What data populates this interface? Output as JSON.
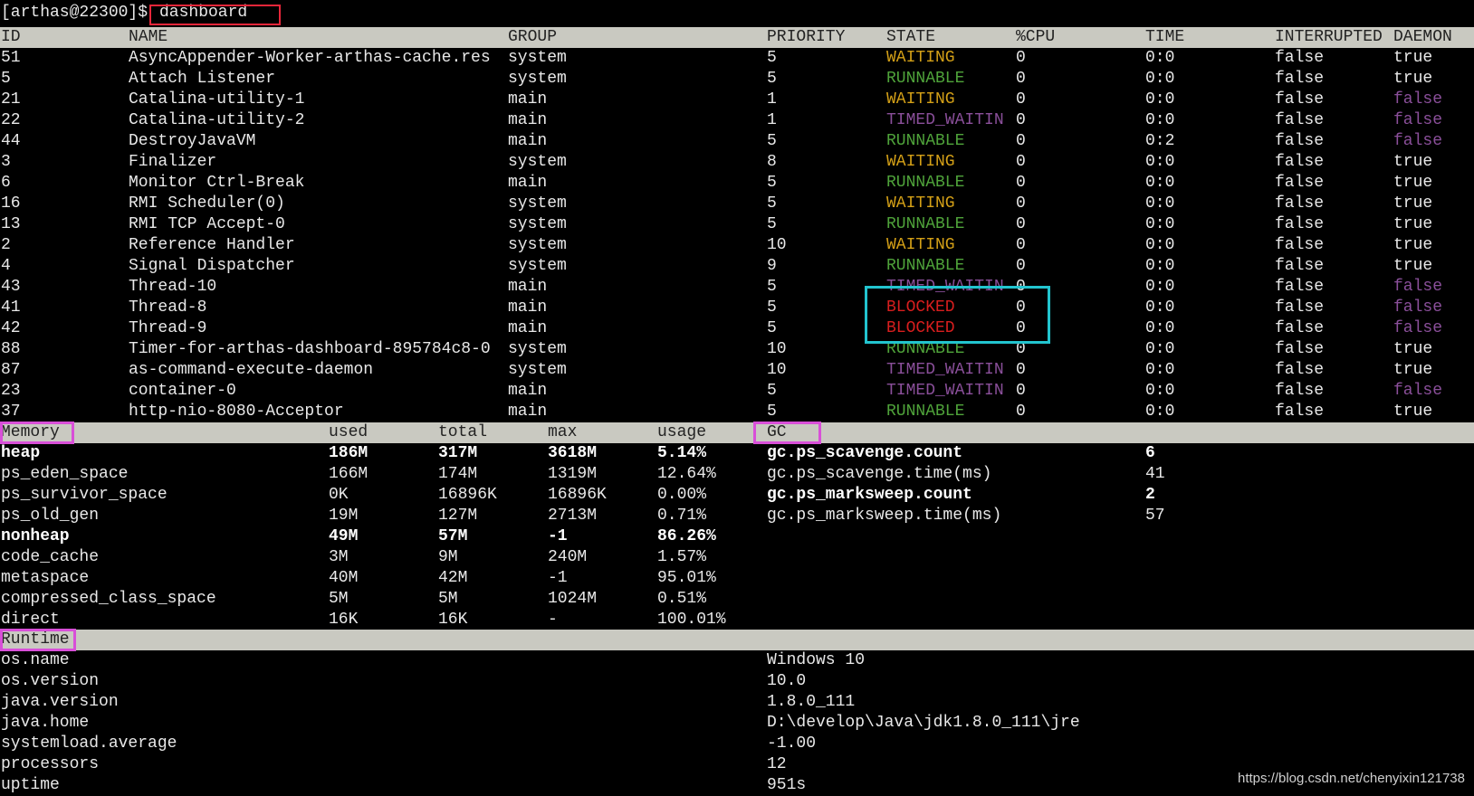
{
  "prompt": {
    "text": "[arthas@22300]$ ",
    "command": "dashboard"
  },
  "threads": {
    "headers": [
      "ID",
      "NAME",
      "GROUP",
      "PRIORITY",
      "STATE",
      "%CPU",
      "TIME",
      "INTERRUPTED",
      "DAEMON"
    ],
    "rows": [
      {
        "id": "51",
        "name": "AsyncAppender-Worker-arthas-cache.res",
        "group": "system",
        "priority": "5",
        "state": "WAITING",
        "cpu": "0",
        "time": "0:0",
        "interrupted": "false",
        "daemon": "true"
      },
      {
        "id": "5",
        "name": "Attach Listener",
        "group": "system",
        "priority": "5",
        "state": "RUNNABLE",
        "cpu": "0",
        "time": "0:0",
        "interrupted": "false",
        "daemon": "true"
      },
      {
        "id": "21",
        "name": "Catalina-utility-1",
        "group": "main",
        "priority": "1",
        "state": "WAITING",
        "cpu": "0",
        "time": "0:0",
        "interrupted": "false",
        "daemon": "false"
      },
      {
        "id": "22",
        "name": "Catalina-utility-2",
        "group": "main",
        "priority": "1",
        "state": "TIMED_WAITIN",
        "cpu": "0",
        "time": "0:0",
        "interrupted": "false",
        "daemon": "false"
      },
      {
        "id": "44",
        "name": "DestroyJavaVM",
        "group": "main",
        "priority": "5",
        "state": "RUNNABLE",
        "cpu": "0",
        "time": "0:2",
        "interrupted": "false",
        "daemon": "false"
      },
      {
        "id": "3",
        "name": "Finalizer",
        "group": "system",
        "priority": "8",
        "state": "WAITING",
        "cpu": "0",
        "time": "0:0",
        "interrupted": "false",
        "daemon": "true"
      },
      {
        "id": "6",
        "name": "Monitor Ctrl-Break",
        "group": "main",
        "priority": "5",
        "state": "RUNNABLE",
        "cpu": "0",
        "time": "0:0",
        "interrupted": "false",
        "daemon": "true"
      },
      {
        "id": "16",
        "name": "RMI Scheduler(0)",
        "group": "system",
        "priority": "5",
        "state": "WAITING",
        "cpu": "0",
        "time": "0:0",
        "interrupted": "false",
        "daemon": "true"
      },
      {
        "id": "13",
        "name": "RMI TCP Accept-0",
        "group": "system",
        "priority": "5",
        "state": "RUNNABLE",
        "cpu": "0",
        "time": "0:0",
        "interrupted": "false",
        "daemon": "true"
      },
      {
        "id": "2",
        "name": "Reference Handler",
        "group": "system",
        "priority": "10",
        "state": "WAITING",
        "cpu": "0",
        "time": "0:0",
        "interrupted": "false",
        "daemon": "true"
      },
      {
        "id": "4",
        "name": "Signal Dispatcher",
        "group": "system",
        "priority": "9",
        "state": "RUNNABLE",
        "cpu": "0",
        "time": "0:0",
        "interrupted": "false",
        "daemon": "true"
      },
      {
        "id": "43",
        "name": "Thread-10",
        "group": "main",
        "priority": "5",
        "state": "TIMED_WAITIN",
        "cpu": "0",
        "time": "0:0",
        "interrupted": "false",
        "daemon": "false"
      },
      {
        "id": "41",
        "name": "Thread-8",
        "group": "main",
        "priority": "5",
        "state": "BLOCKED",
        "cpu": "0",
        "time": "0:0",
        "interrupted": "false",
        "daemon": "false"
      },
      {
        "id": "42",
        "name": "Thread-9",
        "group": "main",
        "priority": "5",
        "state": "BLOCKED",
        "cpu": "0",
        "time": "0:0",
        "interrupted": "false",
        "daemon": "false"
      },
      {
        "id": "88",
        "name": "Timer-for-arthas-dashboard-895784c8-0",
        "group": "system",
        "priority": "10",
        "state": "RUNNABLE",
        "cpu": "0",
        "time": "0:0",
        "interrupted": "false",
        "daemon": "true"
      },
      {
        "id": "87",
        "name": "as-command-execute-daemon",
        "group": "system",
        "priority": "10",
        "state": "TIMED_WAITIN",
        "cpu": "0",
        "time": "0:0",
        "interrupted": "false",
        "daemon": "true"
      },
      {
        "id": "23",
        "name": "container-0",
        "group": "main",
        "priority": "5",
        "state": "TIMED_WAITIN",
        "cpu": "0",
        "time": "0:0",
        "interrupted": "false",
        "daemon": "false"
      },
      {
        "id": "37",
        "name": "http-nio-8080-Acceptor",
        "group": "main",
        "priority": "5",
        "state": "RUNNABLE",
        "cpu": "0",
        "time": "0:0",
        "interrupted": "false",
        "daemon": "true"
      }
    ]
  },
  "memory": {
    "headers": [
      "Memory",
      "used",
      "total",
      "max",
      "usage"
    ],
    "rows": [
      {
        "name": "heap",
        "used": "186M",
        "total": "317M",
        "max": "3618M",
        "usage": "5.14%",
        "bold": true
      },
      {
        "name": "ps_eden_space",
        "used": "166M",
        "total": "174M",
        "max": "1319M",
        "usage": "12.64%",
        "bold": false
      },
      {
        "name": "ps_survivor_space",
        "used": "0K",
        "total": "16896K",
        "max": "16896K",
        "usage": "0.00%",
        "bold": false
      },
      {
        "name": "ps_old_gen",
        "used": "19M",
        "total": "127M",
        "max": "2713M",
        "usage": "0.71%",
        "bold": false
      },
      {
        "name": "nonheap",
        "used": "49M",
        "total": "57M",
        "max": "-1",
        "usage": "86.26%",
        "bold": true
      },
      {
        "name": "code_cache",
        "used": "3M",
        "total": "9M",
        "max": "240M",
        "usage": "1.57%",
        "bold": false
      },
      {
        "name": "metaspace",
        "used": "40M",
        "total": "42M",
        "max": "-1",
        "usage": "95.01%",
        "bold": false
      },
      {
        "name": "compressed_class_space",
        "used": "5M",
        "total": "5M",
        "max": "1024M",
        "usage": "0.51%",
        "bold": false
      },
      {
        "name": "direct",
        "used": "16K",
        "total": "16K",
        "max": "-",
        "usage": "100.01%",
        "bold": false
      }
    ]
  },
  "gc": {
    "header": "GC",
    "rows": [
      {
        "name": "gc.ps_scavenge.count",
        "value": "6",
        "bold": true
      },
      {
        "name": "gc.ps_scavenge.time(ms)",
        "value": "41",
        "bold": false
      },
      {
        "name": "gc.ps_marksweep.count",
        "value": "2",
        "bold": true
      },
      {
        "name": "gc.ps_marksweep.time(ms)",
        "value": "57",
        "bold": false
      }
    ]
  },
  "runtime": {
    "header": "Runtime",
    "rows": [
      {
        "name": "os.name",
        "value": "Windows 10"
      },
      {
        "name": "os.version",
        "value": "10.0"
      },
      {
        "name": "java.version",
        "value": "1.8.0_111"
      },
      {
        "name": "java.home",
        "value": "D:\\develop\\Java\\jdk1.8.0_111\\jre"
      },
      {
        "name": "systemload.average",
        "value": "-1.00"
      },
      {
        "name": "processors",
        "value": "12"
      },
      {
        "name": "uptime",
        "value": "951s"
      }
    ]
  },
  "colors": {
    "WAITING": "#d4a017",
    "RUNNABLE": "#4fa33a",
    "TIMED_WAITIN": "#8a4f9a",
    "BLOCKED": "#d81e1e",
    "daemon_false": "#8a4f9a",
    "text": "#e8e8e8"
  },
  "watermark": "https://blog.csdn.net/chenyixin121738"
}
